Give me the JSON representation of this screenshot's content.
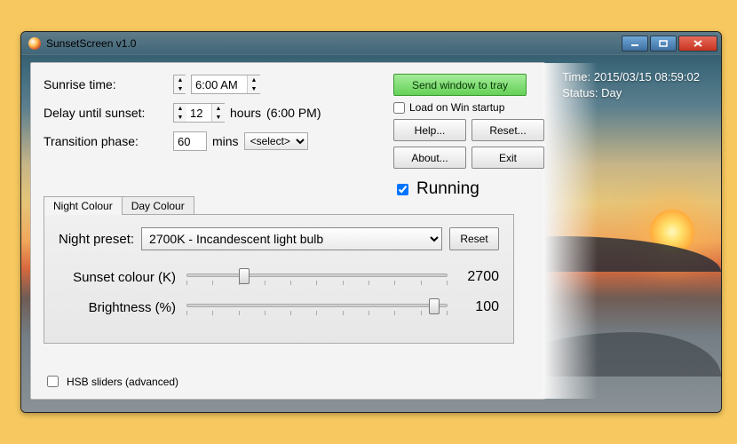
{
  "window": {
    "title": "SunsetScreen v1.0"
  },
  "settings": {
    "sunrise_label": "Sunrise time:",
    "sunrise_value": "6:00 AM",
    "delay_label": "Delay until sunset:",
    "delay_value": "12",
    "delay_unit": "hours",
    "delay_derived": "(6:00 PM)",
    "transition_label": "Transition phase:",
    "transition_value": "60",
    "transition_unit": "mins",
    "transition_select": "<select>"
  },
  "actions": {
    "send_to_tray": "Send window to tray",
    "load_on_startup": "Load on Win startup",
    "help": "Help...",
    "reset": "Reset...",
    "about": "About...",
    "exit": "Exit",
    "running_label": "Running",
    "running_checked": true
  },
  "tabs": {
    "night": "Night Colour",
    "day": "Day Colour"
  },
  "preset": {
    "label": "Night preset:",
    "selected": "2700K - Incandescent light bulb",
    "reset": "Reset"
  },
  "sliders": {
    "colour_label": "Sunset colour (K)",
    "colour_value": "2700",
    "colour_pos_pct": 22,
    "brightness_label": "Brightness (%)",
    "brightness_value": "100",
    "brightness_pos_pct": 95
  },
  "hsb": {
    "label": "HSB sliders (advanced)",
    "checked": false
  },
  "overlay": {
    "time_line": "Time: 2015/03/15 08:59:02",
    "status_line": "Status: Day"
  }
}
